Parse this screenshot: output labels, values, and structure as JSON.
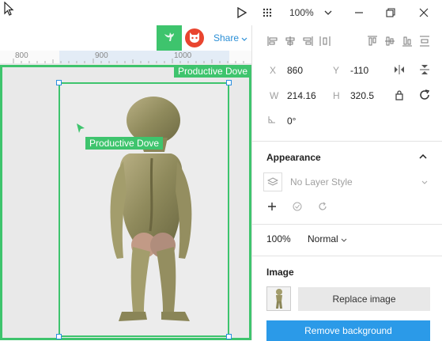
{
  "titlebar": {
    "zoom": "100%"
  },
  "toolbar": {
    "share_label": "Share"
  },
  "ruler": {
    "ticks": [
      "800",
      "900",
      "1000"
    ]
  },
  "canvas": {
    "artboard_name": "Productive Dove",
    "layer_tooltip": "Productive Dove"
  },
  "properties": {
    "x_label": "X",
    "x_value": "860",
    "y_label": "Y",
    "y_value": "-110",
    "w_label": "W",
    "w_value": "214.16",
    "h_label": "H",
    "h_value": "320.5",
    "rotation_value": "0°"
  },
  "appearance": {
    "title": "Appearance",
    "layer_style": "No Layer Style",
    "opacity": "100%",
    "blend_mode": "Normal"
  },
  "image": {
    "title": "Image",
    "replace_label": "Replace image",
    "remove_label": "Remove background"
  },
  "colors": {
    "accent_green": "#3ec46d",
    "accent_blue": "#2b9ae8"
  }
}
